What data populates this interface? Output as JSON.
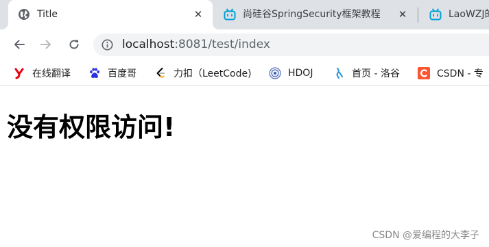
{
  "browser": {
    "tabs": [
      {
        "title": "Title",
        "favicon": "globe-icon",
        "active": true
      },
      {
        "title": "尚硅谷SpringSecurity框架教程",
        "favicon": "bilibili-icon",
        "active": false
      },
      {
        "title": "LaoWZJ的",
        "favicon": "bilibili-icon",
        "active": false
      }
    ],
    "close_glyph": "✕",
    "address": {
      "host": "localhost",
      "rest": ":8081/test/index"
    },
    "bookmarks": [
      {
        "label": "在线翻译",
        "icon": "youdao-icon"
      },
      {
        "label": "百度哥",
        "icon": "baidu-paw-icon"
      },
      {
        "label": "力扣（LeetCode)",
        "icon": "leetcode-icon"
      },
      {
        "label": "HDOJ",
        "icon": "hdoj-icon"
      },
      {
        "label": "首页 - 洛谷",
        "icon": "luogu-icon"
      },
      {
        "label": "CSDN - 专",
        "icon": "csdn-icon"
      }
    ],
    "colors": {
      "tabstrip": "#dee1e6",
      "omnibox": "#f1f3f4",
      "bilibili": "#00a1d6",
      "csdn": "#fc5531",
      "youdao": "#e60012",
      "baidu": "#2932e1"
    }
  },
  "page": {
    "heading": "没有权限访问!",
    "watermark": "CSDN @爱编程的大李子"
  }
}
